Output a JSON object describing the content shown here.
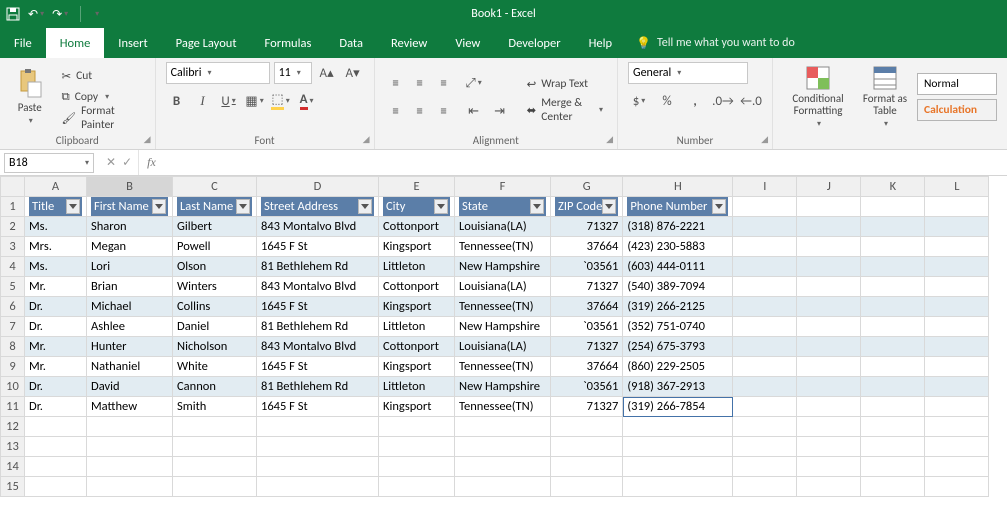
{
  "app": {
    "title": "Book1 - Excel"
  },
  "ribbon": {
    "tabs": [
      "File",
      "Home",
      "Insert",
      "Page Layout",
      "Formulas",
      "Data",
      "Review",
      "View",
      "Developer",
      "Help"
    ],
    "active_tab": "Home",
    "tell_me": "Tell me what you want to do",
    "groups": {
      "clipboard": {
        "label": "Clipboard",
        "paste": "Paste",
        "cut": "Cut",
        "copy": "Copy",
        "fmt": "Format Painter"
      },
      "font": {
        "label": "Font",
        "name": "Calibri",
        "size": "11"
      },
      "alignment": {
        "label": "Alignment",
        "wrap": "Wrap Text",
        "merge": "Merge & Center"
      },
      "number": {
        "label": "Number",
        "format": "General"
      },
      "styles": {
        "cond": "Conditional Formatting",
        "table": "Format as Table",
        "normal": "Normal",
        "calc": "Calculation"
      }
    }
  },
  "formula_bar": {
    "name": "B18",
    "value": ""
  },
  "columns": [
    "A",
    "B",
    "C",
    "D",
    "E",
    "F",
    "G",
    "H",
    "I",
    "J",
    "K",
    "L"
  ],
  "headers": [
    "Title",
    "First Name",
    "Last Name",
    "Street Address",
    "City",
    "State",
    "ZIP Code",
    "Phone Number"
  ],
  "rows": [
    {
      "n": 2,
      "band": true,
      "c": [
        "Ms.",
        "Sharon",
        "Gilbert",
        "843 Montalvo Blvd",
        "Cottonport",
        "Louisiana(LA)",
        "71327",
        "(318) 876-2221"
      ]
    },
    {
      "n": 3,
      "band": false,
      "c": [
        "Mrs.",
        "Megan",
        "Powell",
        "1645 F St",
        "Kingsport",
        "Tennessee(TN)",
        "37664",
        "(423) 230-5883"
      ]
    },
    {
      "n": 4,
      "band": true,
      "c": [
        "Ms.",
        "Lori",
        "Olson",
        "81 Bethlehem Rd",
        "Littleton",
        "New Hampshire",
        "`03561",
        "(603) 444-0111"
      ]
    },
    {
      "n": 5,
      "band": false,
      "c": [
        "Mr.",
        "Brian",
        "Winters",
        "843 Montalvo Blvd",
        "Cottonport",
        "Louisiana(LA)",
        "71327",
        "(540) 389-7094"
      ]
    },
    {
      "n": 6,
      "band": true,
      "c": [
        "Dr.",
        "Michael",
        "Collins",
        "1645 F St",
        "Kingsport",
        "Tennessee(TN)",
        "37664",
        "(319) 266-2125"
      ]
    },
    {
      "n": 7,
      "band": false,
      "c": [
        "Dr.",
        "Ashlee",
        "Daniel",
        "81 Bethlehem Rd",
        "Littleton",
        "New Hampshire",
        "`03561",
        "(352) 751-0740"
      ]
    },
    {
      "n": 8,
      "band": true,
      "c": [
        "Mr.",
        "Hunter",
        "Nicholson",
        "843 Montalvo Blvd",
        "Cottonport",
        "Louisiana(LA)",
        "71327",
        "(254) 675-3793"
      ]
    },
    {
      "n": 9,
      "band": false,
      "c": [
        "Mr.",
        "Nathaniel",
        "White",
        "1645 F St",
        "Kingsport",
        "Tennessee(TN)",
        "37664",
        "(860) 229-2505"
      ]
    },
    {
      "n": 10,
      "band": true,
      "c": [
        "Dr.",
        "David",
        "Cannon",
        "81 Bethlehem Rd",
        "Littleton",
        "New Hampshire",
        "`03561",
        "(918) 367-2913"
      ]
    },
    {
      "n": 11,
      "band": false,
      "c": [
        "Dr.",
        "Matthew",
        "Smith",
        "1645 F St",
        "Kingsport",
        "Tennessee(TN)",
        "71327",
        "(319) 266-7854"
      ]
    }
  ],
  "empty_rows": [
    12,
    13,
    14,
    15
  ]
}
